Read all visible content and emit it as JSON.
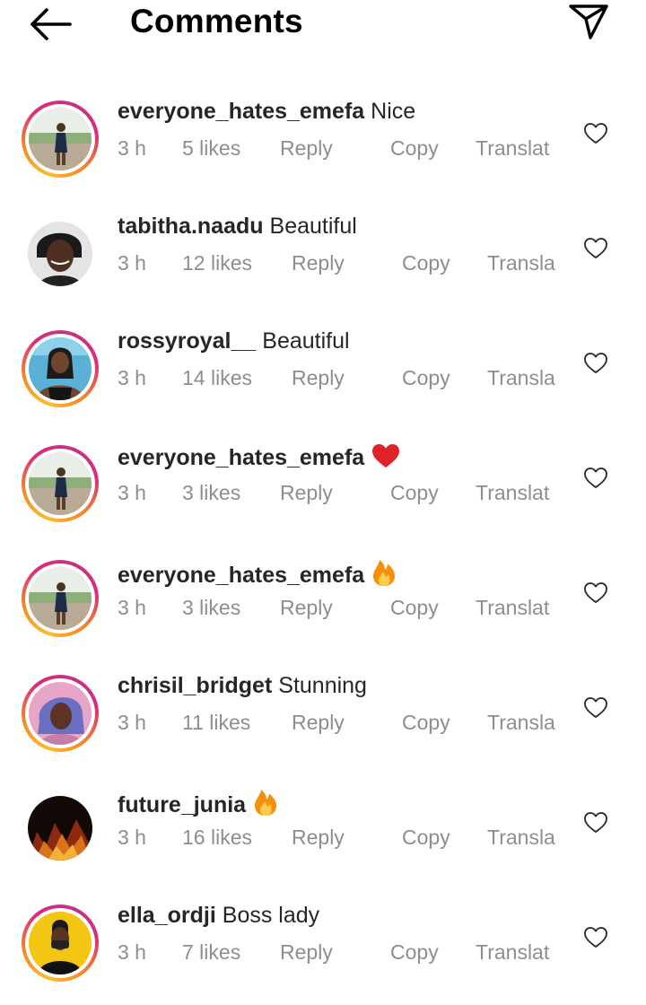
{
  "header": {
    "title": "Comments",
    "back_icon": "arrow-left-icon",
    "share_icon": "paper-plane-icon"
  },
  "colors": {
    "text": "#262626",
    "meta": "#8e8e8e",
    "heart": "#e0222b",
    "story_ring": [
      "#fdbb2d",
      "#f58529",
      "#dd2a7b",
      "#c13584"
    ]
  },
  "comments": [
    {
      "username": "everyone_hates_emefa",
      "text": "Nice",
      "emoji": "",
      "time": "3 h",
      "likes": "5 likes",
      "reply": "Reply",
      "copy": "Copy",
      "translate": "Translat"
    },
    {
      "username": "tabitha.naadu",
      "text": "Beautiful",
      "emoji": "",
      "time": "3 h",
      "likes": "12 likes",
      "reply": "Reply",
      "copy": "Copy",
      "translate": "Transla"
    },
    {
      "username": "rossyroyal__",
      "text": "Beautiful",
      "emoji": "",
      "time": "3 h",
      "likes": "14 likes",
      "reply": "Reply",
      "copy": "Copy",
      "translate": "Transla"
    },
    {
      "username": "everyone_hates_emefa",
      "text": "",
      "emoji": "red-heart",
      "time": "3 h",
      "likes": "3 likes",
      "reply": "Reply",
      "copy": "Copy",
      "translate": "Translat"
    },
    {
      "username": "everyone_hates_emefa",
      "text": "",
      "emoji": "fire",
      "time": "3 h",
      "likes": "3 likes",
      "reply": "Reply",
      "copy": "Copy",
      "translate": "Translat"
    },
    {
      "username": "chrisil_bridget",
      "text": "Stunning",
      "emoji": "",
      "time": "3 h",
      "likes": "11 likes",
      "reply": "Reply",
      "copy": "Copy",
      "translate": "Transla"
    },
    {
      "username": "future_junia",
      "text": "",
      "emoji": "fire",
      "time": "3 h",
      "likes": "16 likes",
      "reply": "Reply",
      "copy": "Copy",
      "translate": "Transla"
    },
    {
      "username": "ella_ordji",
      "text": "Boss lady",
      "emoji": "",
      "time": "3 h",
      "likes": "7 likes",
      "reply": "Reply",
      "copy": "Copy",
      "translate": "Translat"
    }
  ]
}
